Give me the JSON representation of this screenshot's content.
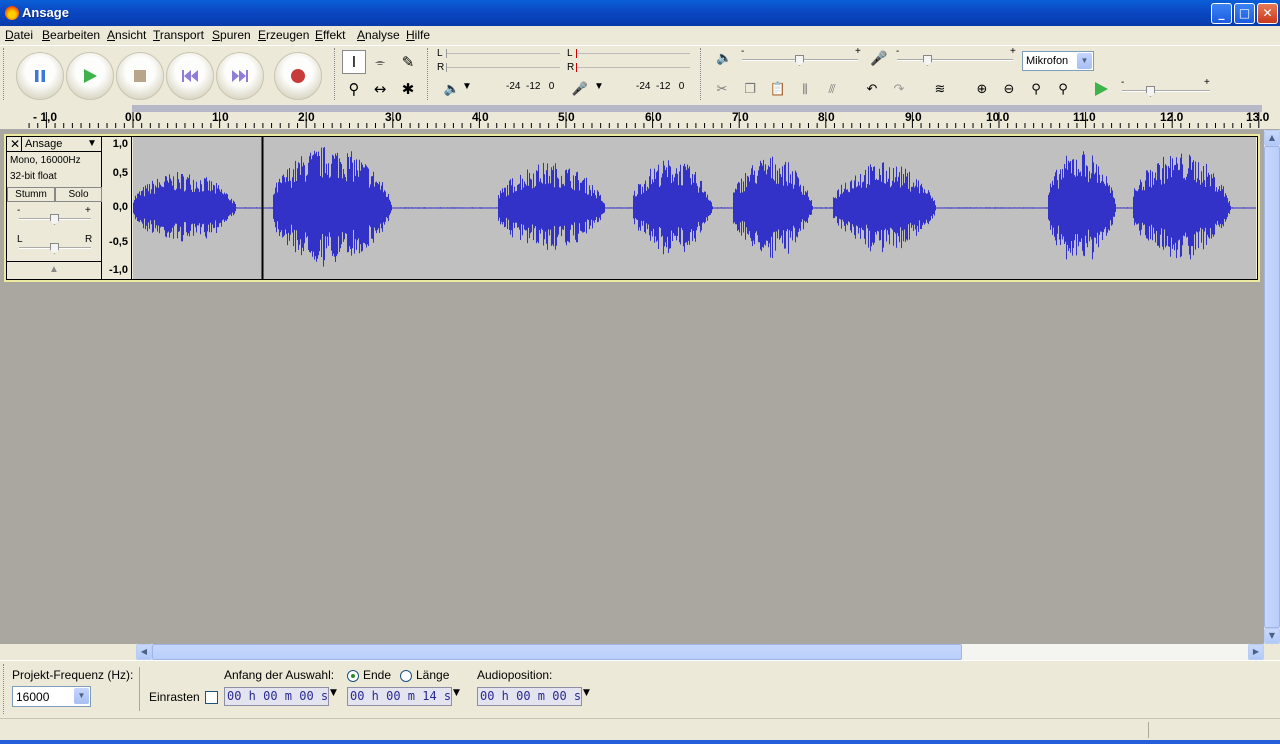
{
  "window": {
    "title": "Ansage",
    "minimize": "_",
    "maximize": "□",
    "close": "✕"
  },
  "menu": [
    "Datei",
    "Bearbeiten",
    "Ansicht",
    "Transport",
    "Spuren",
    "Erzeugen",
    "Effekt",
    "Analyse",
    "Hilfe"
  ],
  "meters": {
    "play_L": "L",
    "play_R": "R",
    "rec_L": "L",
    "rec_R": "R",
    "play_scale": "-24  -12   0",
    "rec_scale": "-24  -12   0",
    "slider_minus": "-",
    "slider_plus": "+"
  },
  "mixer": {
    "input_source": "Mikrofon"
  },
  "ruler": {
    "labels": [
      "- 1,0",
      "0.0",
      "1.0",
      "2.0",
      "3.0",
      "4.0",
      "5.0",
      "6.0",
      "7.0",
      "8.0",
      "9.0",
      "10.0",
      "11.0",
      "12.0",
      "13.0"
    ]
  },
  "track": {
    "name": "Ansage",
    "info_line1": "Mono, 16000Hz",
    "info_line2": "32-bit float",
    "mute": "Stumm",
    "solo": "Solo",
    "gain_minus": "-",
    "gain_plus": "+",
    "pan_left": "L",
    "pan_right": "R",
    "vruler": [
      "1,0",
      "0,5",
      "0,0",
      "-0,5",
      "-1,0"
    ]
  },
  "selection_bar": {
    "project_rate_label": "Projekt-Frequenz (Hz):",
    "project_rate": "16000",
    "snap_label": "Einrasten",
    "selection_start_label": "Anfang der Auswahl:",
    "end_label": "Ende",
    "length_label": "Länge",
    "selection_start": "00 h 00 m 00 s",
    "selection_end": "00 h 00 m 14 s",
    "audio_position_label": "Audioposition:",
    "audio_position": "00 h 00 m 00 s"
  },
  "colors": {
    "waveform": "#3232c8",
    "waveform_bg": "#c0c0c0",
    "titlebar": "#0b49c5"
  }
}
